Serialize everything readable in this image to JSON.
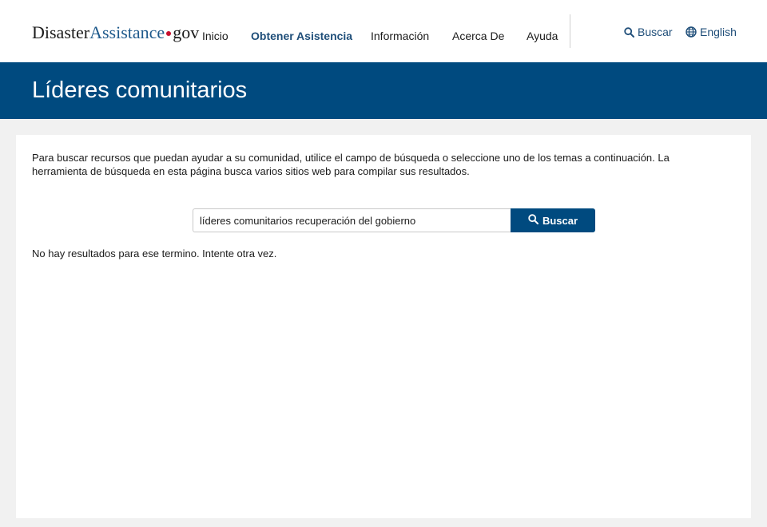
{
  "header": {
    "logo": {
      "part1": "Disaster",
      "part2": "Assistance",
      "part3": "gov"
    },
    "nav": [
      {
        "label": "Inicio"
      },
      {
        "label": "Obtener Asistencia"
      },
      {
        "label": "Información"
      },
      {
        "label": "Acerca De"
      },
      {
        "label": "Ayuda"
      }
    ],
    "search_label": "Buscar",
    "language_label": "English"
  },
  "banner": {
    "title": "Líderes comunitarios"
  },
  "main": {
    "intro": "Para buscar recursos que puedan ayudar a su comunidad, utilice el campo de búsqueda o seleccione uno de los temas a continuación. La herramienta de búsqueda en esta página busca varios sitios web para compilar sus resultados.",
    "search_value": "líderes comunitarios recuperación del gobierno",
    "search_button": "Buscar",
    "no_results": "No hay resultados para ese termino. Intente otra vez."
  },
  "colors": {
    "primary": "#004a7f",
    "nav_active": "#1f4e79",
    "logo_accent": "#1f5a8c",
    "logo_dot": "#c8102e",
    "page_bg": "#f1f1f1"
  },
  "icons": [
    "search-icon",
    "globe-icon"
  ]
}
